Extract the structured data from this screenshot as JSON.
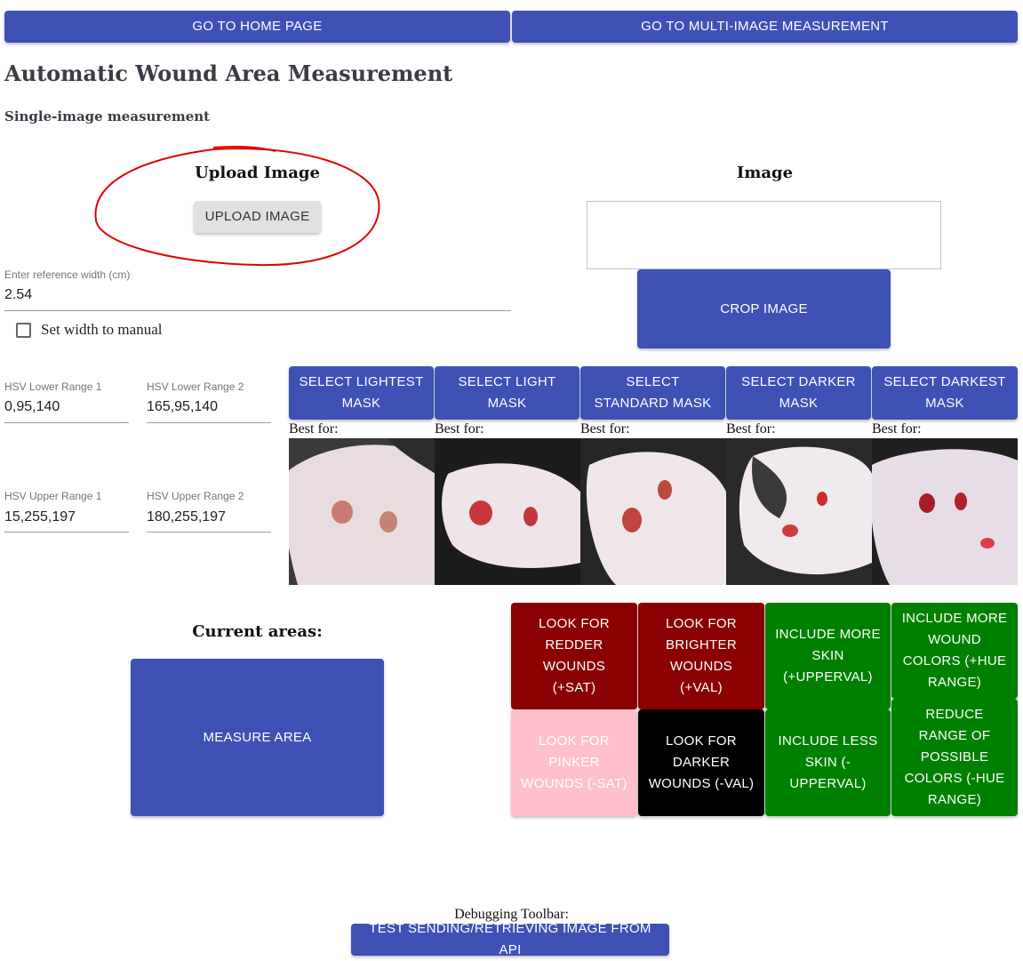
{
  "nav": {
    "home_label": "GO TO HOME PAGE",
    "multi_label": "GO TO MULTI-IMAGE MEASUREMENT"
  },
  "header": {
    "title": "Automatic Wound Area Measurement",
    "subtitle": "Single-image measurement"
  },
  "upload": {
    "heading": "Upload Image",
    "button_label": "UPLOAD IMAGE"
  },
  "image_panel": {
    "heading": "Image",
    "crop_label": "CROP IMAGE"
  },
  "reference": {
    "label": "Enter reference width (cm)",
    "value": "2.54",
    "manual_label": "Set width to manual"
  },
  "hsv": {
    "lower1_label": "HSV Lower Range 1",
    "lower1_value": "0,95,140",
    "lower2_label": "HSV Lower Range 2",
    "lower2_value": "165,95,140",
    "upper1_label": "HSV Upper Range 1",
    "upper1_value": "15,255,197",
    "upper2_label": "HSV Upper Range 2",
    "upper2_value": "180,255,197"
  },
  "masks": [
    {
      "label": "SELECT LIGHTEST MASK",
      "best_for": "Best for:"
    },
    {
      "label": "SELECT LIGHT MASK",
      "best_for": "Best for:"
    },
    {
      "label": "SELECT STANDARD MASK",
      "best_for": "Best for:"
    },
    {
      "label": "SELECT DARKER MASK",
      "best_for": "Best for:"
    },
    {
      "label": "SELECT DARKEST MASK",
      "best_for": "Best for:"
    }
  ],
  "areas": {
    "heading": "Current areas:",
    "measure_label": "MEASURE AREA"
  },
  "adjust": {
    "redder": "LOOK FOR REDDER WOUNDS (+SAT)",
    "brighter": "LOOK FOR BRIGHTER WOUNDS (+VAL)",
    "more_skin": "INCLUDE MORE SKIN (+UPPERVAL)",
    "more_colors": "INCLUDE MORE WOUND COLORS (+HUE RANGE)",
    "pinker": "LOOK FOR PINKER WOUNDS (-SAT)",
    "darker": "LOOK FOR DARKER WOUNDS (-VAL)",
    "less_skin": "INCLUDE LESS SKIN (-UPPERVAL)",
    "reduce_colors": "REDUCE RANGE OF POSSIBLE COLORS (-HUE RANGE)"
  },
  "debug": {
    "label": "Debugging Toolbar:",
    "test_label": "TEST SENDING/RETRIEVING IMAGE FROM API"
  },
  "colors": {
    "primary": "#3f51b5",
    "dark_red": "#8b0000",
    "pink": "#ffc0cb",
    "black": "#000000",
    "green": "#008000",
    "annotation_red": "#e00000"
  }
}
